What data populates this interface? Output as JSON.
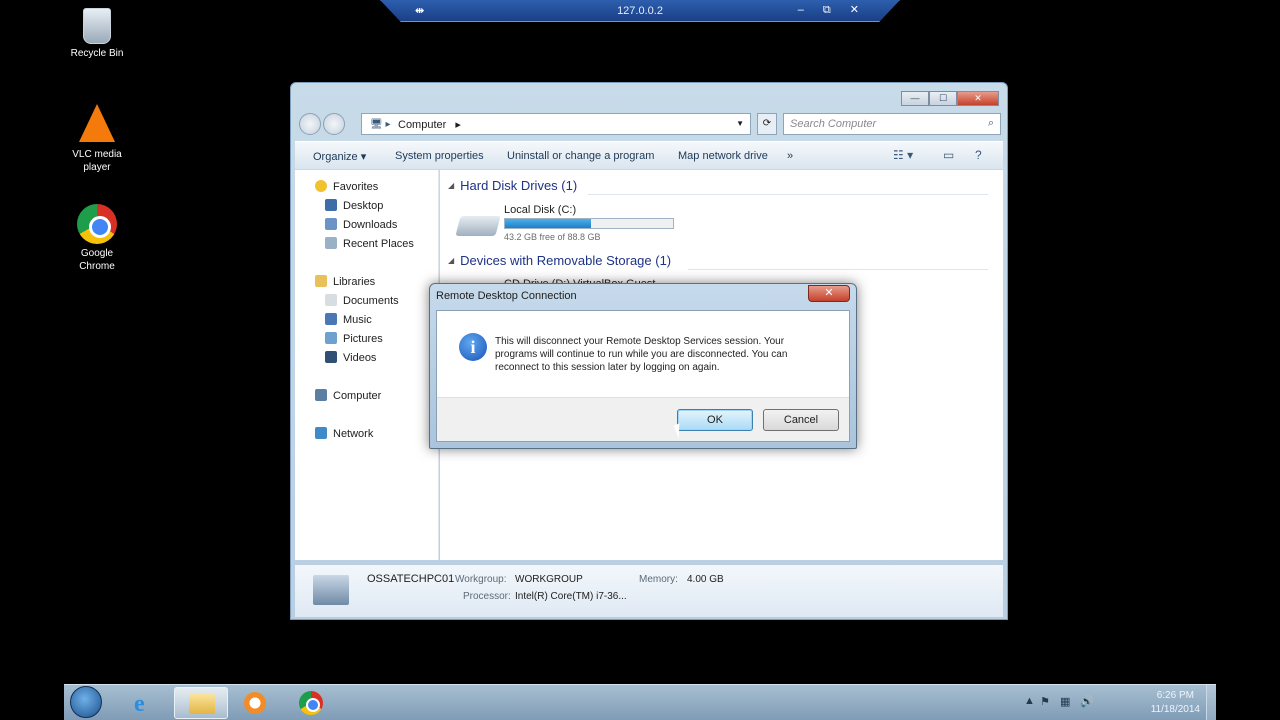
{
  "rdp_bar": {
    "title": "127.0.0.2",
    "pin": "⇹",
    "ctrls": "– ⧉ ✕"
  },
  "desktop": {
    "icons": [
      {
        "label": "Recycle Bin",
        "icon": "recycle-bin-icon"
      },
      {
        "label": "VLC media player",
        "icon": "vlc-icon"
      },
      {
        "label": "Google Chrome",
        "icon": "chrome-icon"
      }
    ]
  },
  "explorer": {
    "address": {
      "location": "Computer",
      "sep": "▸"
    },
    "search_placeholder": "Search Computer",
    "toolbar": {
      "organize": "Organize ▾",
      "system_properties": "System properties",
      "uninstall": "Uninstall or change a program",
      "map_drive": "Map network drive",
      "more": "»"
    },
    "nav": {
      "favorites": "Favorites",
      "desktop": "Desktop",
      "downloads": "Downloads",
      "recent": "Recent Places",
      "libraries": "Libraries",
      "documents": "Documents",
      "music": "Music",
      "pictures": "Pictures",
      "videos": "Videos",
      "computer": "Computer",
      "network": "Network"
    },
    "groups": {
      "hdd": "Hard Disk Drives (1)",
      "removable": "Devices with Removable Storage (1)"
    },
    "drive": {
      "name": "Local Disk (C:)",
      "free": "43.2 GB free of 88.8 GB",
      "used_fraction": 0.51,
      "fill_color": "#1f7fc8"
    },
    "cd": {
      "name": "CD Drive (D:) VirtualBox Guest"
    },
    "details": {
      "computer_name": "OSSATECHPC01",
      "workgroup_label": "Workgroup:",
      "workgroup": "WORKGROUP",
      "memory_label": "Memory:",
      "memory": "4.00 GB",
      "processor_label": "Processor:",
      "processor": "Intel(R) Core(TM) i7-36..."
    }
  },
  "dialog": {
    "title": "Remote Desktop Connection",
    "close": "✕",
    "message": "This will disconnect your Remote Desktop Services session. Your programs will continue to run while you are disconnected. You can reconnect to this session later by logging on again.",
    "ok": "OK",
    "cancel": "Cancel"
  },
  "taskbar": {
    "time": "6:26 PM",
    "date": "11/18/2014"
  }
}
